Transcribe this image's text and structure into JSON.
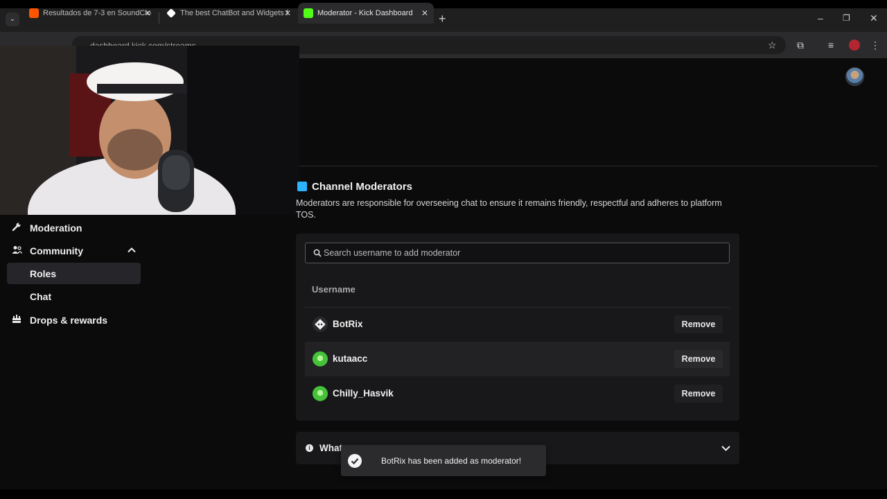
{
  "browser": {
    "tabs": [
      {
        "title": "Resultados de 7-3 en SoundClo",
        "favicon_color": "#ff5500",
        "icon": "soundcloud-icon"
      },
      {
        "title": "The best ChatBot and Widgets f",
        "favicon_color": "#ffffff",
        "icon": "botrix-icon"
      },
      {
        "title": "Moderator - Kick Dashboard",
        "favicon_color": "#53fc18",
        "icon": "kick-icon"
      }
    ],
    "close_glyph": "✕",
    "new_tab_glyph": "+",
    "url": "dashboard.kick.com/streams"
  },
  "sidebar": {
    "items": [
      {
        "label": "Moderation",
        "icon": "wrench-icon"
      },
      {
        "label": "Community",
        "icon": "people-icon",
        "expanded": true
      },
      {
        "label": "Roles",
        "selected": true
      },
      {
        "label": "Chat"
      },
      {
        "label": "Drops & rewards",
        "icon": "gift-icon"
      }
    ]
  },
  "moderators": {
    "title": "Channel Moderators",
    "description": "Moderators are responsible for overseeing chat to ensure it remains friendly, respectful and adheres to platform TOS.",
    "search_placeholder": "Search username to add moderator",
    "column_header": "Username",
    "remove_label": "Remove",
    "rows": [
      {
        "username": "BotRix",
        "avatar_color": "#e8e8e8"
      },
      {
        "username": "kutaacc",
        "avatar_color": "#45c23a"
      },
      {
        "username": "Chilly_Hasvik",
        "avatar_color": "#45c23a"
      }
    ]
  },
  "what_panel": {
    "title": "What"
  },
  "toast": {
    "message": "BotRix has been added as moderator!"
  },
  "colors": {
    "accent": "#53fc18",
    "section_icon": "#2bb3ff"
  }
}
